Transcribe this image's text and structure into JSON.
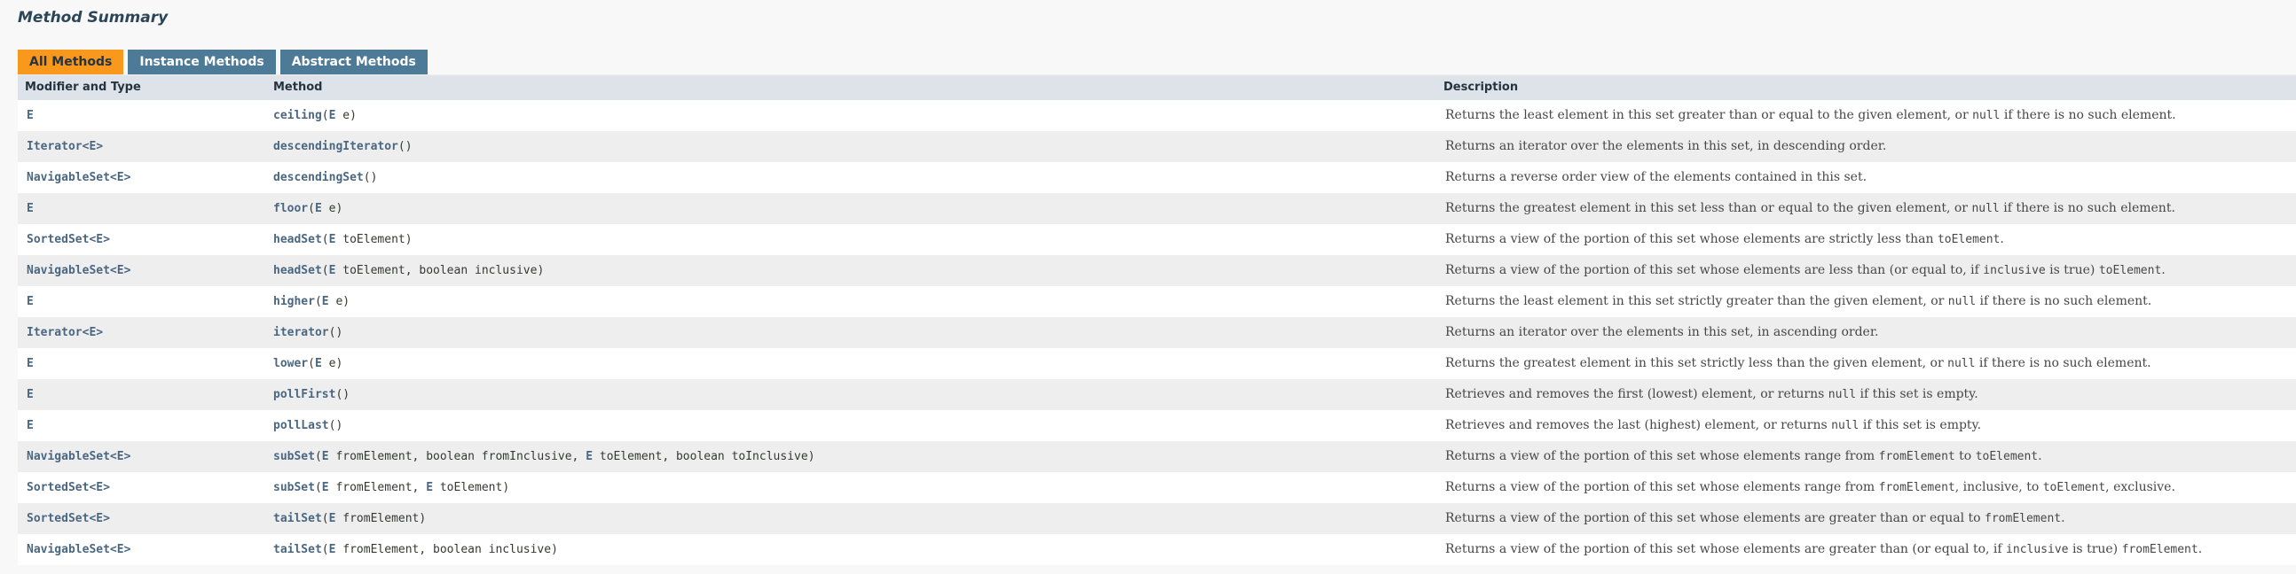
{
  "section_title": "Method Summary",
  "tabs": [
    {
      "label": "All Methods",
      "active": true
    },
    {
      "label": "Instance Methods",
      "active": false
    },
    {
      "label": "Abstract Methods",
      "active": false
    }
  ],
  "columns": {
    "type": "Modifier and Type",
    "method": "Method",
    "description": "Description"
  },
  "colors": {
    "active_tab": "#f8981d",
    "inactive_tab": "#4d7a97",
    "header_bg": "#dee3e9",
    "link": "#4a6782"
  },
  "rows": [
    {
      "type": "E",
      "name": "ceiling",
      "sig": [
        {
          "t": "E",
          "link": true
        },
        {
          "t": " e"
        }
      ],
      "desc": [
        {
          "t": "Returns the least element in this set greater than or equal to the given element, or "
        },
        {
          "t": "null",
          "code": true
        },
        {
          "t": " if there is no such element."
        }
      ]
    },
    {
      "type": "Iterator<E>",
      "name": "descendingIterator",
      "sig": [],
      "desc": [
        {
          "t": "Returns an iterator over the elements in this set, in descending order."
        }
      ]
    },
    {
      "type": "NavigableSet<E>",
      "name": "descendingSet",
      "sig": [],
      "desc": [
        {
          "t": "Returns a reverse order view of the elements contained in this set."
        }
      ]
    },
    {
      "type": "E",
      "name": "floor",
      "sig": [
        {
          "t": "E",
          "link": true
        },
        {
          "t": " e"
        }
      ],
      "desc": [
        {
          "t": "Returns the greatest element in this set less than or equal to the given element, or "
        },
        {
          "t": "null",
          "code": true
        },
        {
          "t": " if there is no such element."
        }
      ]
    },
    {
      "type": "SortedSet<E>",
      "name": "headSet",
      "sig": [
        {
          "t": "E",
          "link": true
        },
        {
          "t": " toElement"
        }
      ],
      "desc": [
        {
          "t": "Returns a view of the portion of this set whose elements are strictly less than "
        },
        {
          "t": "toElement",
          "code": true
        },
        {
          "t": "."
        }
      ]
    },
    {
      "type": "NavigableSet<E>",
      "name": "headSet",
      "sig": [
        {
          "t": "E",
          "link": true
        },
        {
          "t": " toElement, boolean inclusive"
        }
      ],
      "desc": [
        {
          "t": "Returns a view of the portion of this set whose elements are less than (or equal to, if "
        },
        {
          "t": "inclusive",
          "code": true
        },
        {
          "t": " is true) "
        },
        {
          "t": "toElement",
          "code": true
        },
        {
          "t": "."
        }
      ]
    },
    {
      "type": "E",
      "name": "higher",
      "sig": [
        {
          "t": "E",
          "link": true
        },
        {
          "t": " e"
        }
      ],
      "desc": [
        {
          "t": "Returns the least element in this set strictly greater than the given element, or "
        },
        {
          "t": "null",
          "code": true
        },
        {
          "t": " if there is no such element."
        }
      ]
    },
    {
      "type": "Iterator<E>",
      "name": "iterator",
      "sig": [],
      "desc": [
        {
          "t": "Returns an iterator over the elements in this set, in ascending order."
        }
      ]
    },
    {
      "type": "E",
      "name": "lower",
      "sig": [
        {
          "t": "E",
          "link": true
        },
        {
          "t": " e"
        }
      ],
      "desc": [
        {
          "t": "Returns the greatest element in this set strictly less than the given element, or "
        },
        {
          "t": "null",
          "code": true
        },
        {
          "t": " if there is no such element."
        }
      ]
    },
    {
      "type": "E",
      "name": "pollFirst",
      "sig": [],
      "desc": [
        {
          "t": "Retrieves and removes the first (lowest) element, or returns "
        },
        {
          "t": "null",
          "code": true
        },
        {
          "t": " if this set is empty."
        }
      ]
    },
    {
      "type": "E",
      "name": "pollLast",
      "sig": [],
      "desc": [
        {
          "t": "Retrieves and removes the last (highest) element, or returns "
        },
        {
          "t": "null",
          "code": true
        },
        {
          "t": " if this set is empty."
        }
      ]
    },
    {
      "type": "NavigableSet<E>",
      "name": "subSet",
      "sig": [
        {
          "t": "E",
          "link": true
        },
        {
          "t": " fromElement, boolean fromInclusive, "
        },
        {
          "t": "E",
          "link": true
        },
        {
          "t": " toElement, boolean toInclusive"
        }
      ],
      "desc": [
        {
          "t": "Returns a view of the portion of this set whose elements range from "
        },
        {
          "t": "fromElement",
          "code": true
        },
        {
          "t": " to "
        },
        {
          "t": "toElement",
          "code": true
        },
        {
          "t": "."
        }
      ]
    },
    {
      "type": "SortedSet<E>",
      "name": "subSet",
      "sig": [
        {
          "t": "E",
          "link": true
        },
        {
          "t": " fromElement, "
        },
        {
          "t": "E",
          "link": true
        },
        {
          "t": " toElement"
        }
      ],
      "desc": [
        {
          "t": "Returns a view of the portion of this set whose elements range from "
        },
        {
          "t": "fromElement",
          "code": true
        },
        {
          "t": ", inclusive, to "
        },
        {
          "t": "toElement",
          "code": true
        },
        {
          "t": ", exclusive."
        }
      ]
    },
    {
      "type": "SortedSet<E>",
      "name": "tailSet",
      "sig": [
        {
          "t": "E",
          "link": true
        },
        {
          "t": " fromElement"
        }
      ],
      "desc": [
        {
          "t": "Returns a view of the portion of this set whose elements are greater than or equal to "
        },
        {
          "t": "fromElement",
          "code": true
        },
        {
          "t": "."
        }
      ]
    },
    {
      "type": "NavigableSet<E>",
      "name": "tailSet",
      "sig": [
        {
          "t": "E",
          "link": true
        },
        {
          "t": " fromElement, boolean inclusive"
        }
      ],
      "desc": [
        {
          "t": "Returns a view of the portion of this set whose elements are greater than (or equal to, if "
        },
        {
          "t": "inclusive",
          "code": true
        },
        {
          "t": " is true) "
        },
        {
          "t": "fromElement",
          "code": true
        },
        {
          "t": "."
        }
      ]
    }
  ]
}
